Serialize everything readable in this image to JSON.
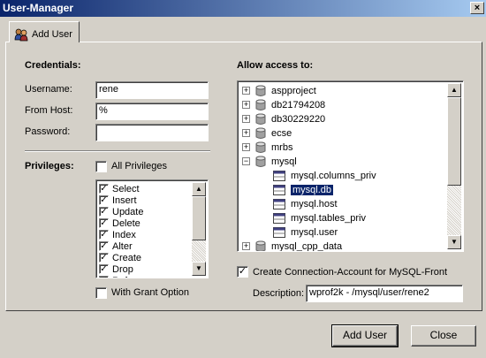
{
  "window": {
    "title": "User-Manager",
    "close_glyph": "×"
  },
  "tabs": [
    {
      "label": "Add User",
      "icon": "users-icon"
    }
  ],
  "credentials": {
    "heading": "Credentials:",
    "username_label": "Username:",
    "username_value": "rene",
    "host_label": "From Host:",
    "host_value": "%",
    "password_label": "Password:",
    "password_value": ""
  },
  "privileges": {
    "heading": "Privileges:",
    "all_label": "All Privileges",
    "all_checked": false,
    "items": [
      {
        "label": "Select",
        "checked": true
      },
      {
        "label": "Insert",
        "checked": true
      },
      {
        "label": "Update",
        "checked": true
      },
      {
        "label": "Delete",
        "checked": true
      },
      {
        "label": "Index",
        "checked": true
      },
      {
        "label": "Alter",
        "checked": true
      },
      {
        "label": "Create",
        "checked": true
      },
      {
        "label": "Drop",
        "checked": true
      },
      {
        "label": "Reference",
        "checked": true
      }
    ],
    "grant_label": "With Grant Option",
    "grant_checked": false
  },
  "access": {
    "heading": "Allow access to:",
    "tree": [
      {
        "label": "aspproject",
        "kind": "database",
        "expander": "+"
      },
      {
        "label": "db21794208",
        "kind": "database",
        "expander": "+"
      },
      {
        "label": "db30229220",
        "kind": "database",
        "expander": "+"
      },
      {
        "label": "ecse",
        "kind": "database",
        "expander": "+"
      },
      {
        "label": "mrbs",
        "kind": "database",
        "expander": "+"
      },
      {
        "label": "mysql",
        "kind": "database",
        "expander": "−"
      },
      {
        "label": "mysql.columns_priv",
        "kind": "table"
      },
      {
        "label": "mysql.db",
        "kind": "table",
        "selected": true
      },
      {
        "label": "mysql.host",
        "kind": "table"
      },
      {
        "label": "mysql.tables_priv",
        "kind": "table"
      },
      {
        "label": "mysql.user",
        "kind": "table"
      },
      {
        "label": "mysql_cpp_data",
        "kind": "database",
        "expander": "+"
      }
    ],
    "create_account_label": "Create Connection-Account for MySQL-Front",
    "create_account_checked": true,
    "description_label": "Description:",
    "description_value": "wprof2k - /mysql/user/rene2"
  },
  "buttons": {
    "add_user": "Add User",
    "close": "Close"
  },
  "colors": {
    "selection": "#0a246a",
    "face": "#d4d0c8"
  }
}
